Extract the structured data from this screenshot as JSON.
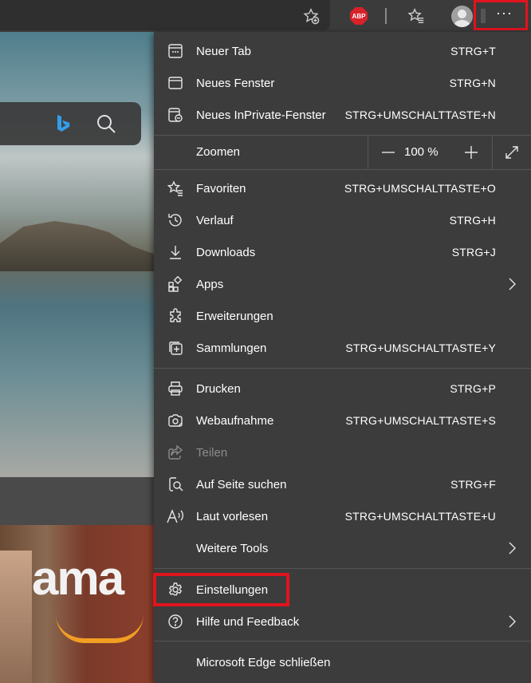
{
  "toolbar": {
    "favorite_add_icon": "star-plus-icon",
    "abp_label": "ABP",
    "favorites_icon": "favorites-star-icon",
    "more_label": "···"
  },
  "background": {
    "news_text": "ama"
  },
  "menu": {
    "new_tab": {
      "label": "Neuer Tab",
      "shortcut": "STRG+T"
    },
    "new_window": {
      "label": "Neues Fenster",
      "shortcut": "STRG+N"
    },
    "new_inprivate": {
      "label": "Neues InPrivate-Fenster",
      "shortcut": "STRG+UMSCHALTTASTE+N"
    },
    "zoom": {
      "label": "Zoomen",
      "value": "100 %",
      "minus": "−",
      "plus": "+"
    },
    "favorites": {
      "label": "Favoriten",
      "shortcut": "STRG+UMSCHALTTASTE+O"
    },
    "history": {
      "label": "Verlauf",
      "shortcut": "STRG+H"
    },
    "downloads": {
      "label": "Downloads",
      "shortcut": "STRG+J"
    },
    "apps": {
      "label": "Apps"
    },
    "extensions": {
      "label": "Erweiterungen"
    },
    "collections": {
      "label": "Sammlungen",
      "shortcut": "STRG+UMSCHALTTASTE+Y"
    },
    "print": {
      "label": "Drucken",
      "shortcut": "STRG+P"
    },
    "web_capture": {
      "label": "Webaufnahme",
      "shortcut": "STRG+UMSCHALTTASTE+S"
    },
    "share": {
      "label": "Teilen"
    },
    "find": {
      "label": "Auf Seite suchen",
      "shortcut": "STRG+F"
    },
    "read_aloud": {
      "label": "Laut vorlesen",
      "shortcut": "STRG+UMSCHALTTASTE+U"
    },
    "more_tools": {
      "label": "Weitere Tools"
    },
    "settings": {
      "label": "Einstellungen"
    },
    "help": {
      "label": "Hilfe und Feedback"
    },
    "close": {
      "label": "Microsoft Edge schließen"
    }
  },
  "colors": {
    "menu_bg": "#3c3c3c",
    "highlight": "#e0141e",
    "abp_red": "#d8222a"
  }
}
